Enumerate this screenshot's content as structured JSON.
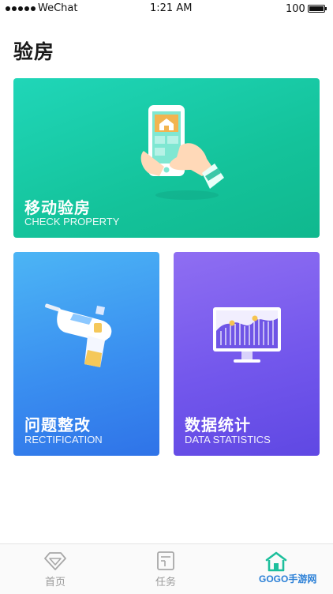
{
  "status_bar": {
    "carrier": "WeChat",
    "time": "1:21 AM",
    "battery": "100"
  },
  "page": {
    "title": "验房"
  },
  "cards": {
    "check_property": {
      "title": "移动验房",
      "subtitle": "CHECK PROPERTY",
      "icon": "phone-hand-illustration"
    },
    "rectification": {
      "title": "问题整改",
      "subtitle": "RECTIFICATION",
      "icon": "drill-illustration"
    },
    "data_statistics": {
      "title": "数据统计",
      "subtitle": "DATA STATISTICS",
      "icon": "monitor-chart-illustration"
    }
  },
  "tabbar": {
    "items": [
      {
        "label": "首页",
        "icon": "diamond-home-icon",
        "active": false
      },
      {
        "label": "任务",
        "icon": "task-document-icon",
        "active": false
      },
      {
        "label": "",
        "icon": "house-icon",
        "active": true
      }
    ]
  },
  "watermark": {
    "text": "GOGO手游网"
  },
  "colors": {
    "accent": "#1dbf9c",
    "card_green": "#14c39b",
    "card_blue": "#3a8ff0",
    "card_purple": "#7357ec"
  }
}
